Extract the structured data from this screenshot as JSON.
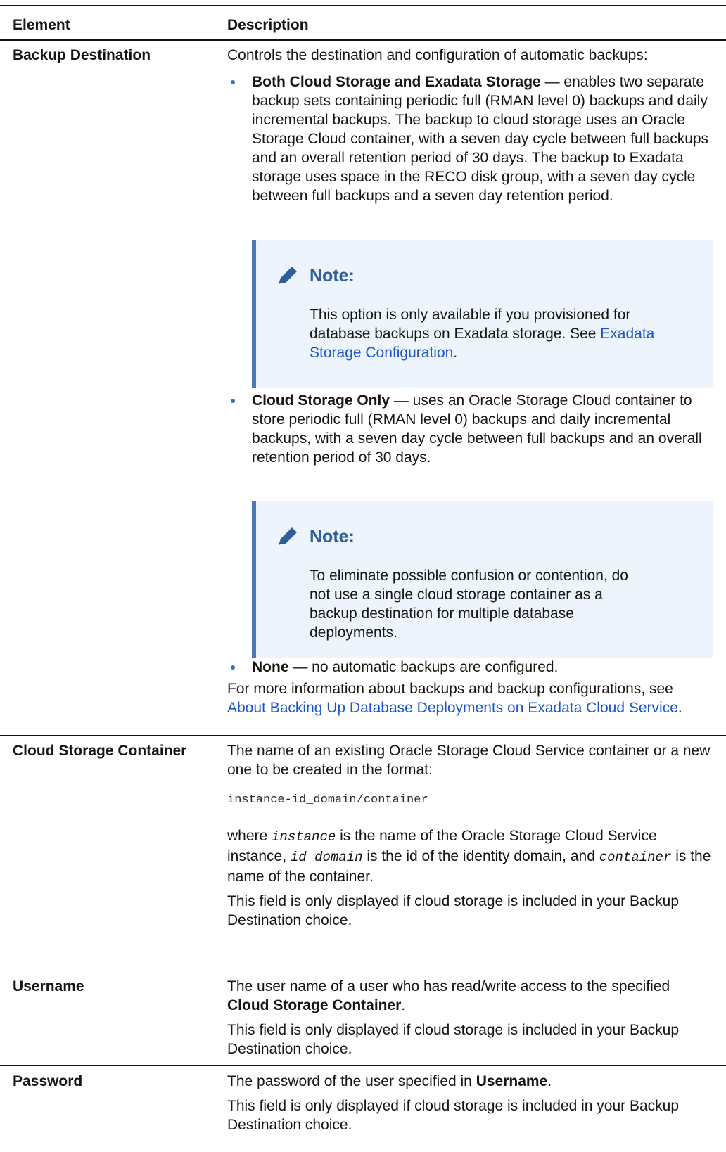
{
  "header": {
    "element": "Element",
    "description": "Description"
  },
  "backup_destination": {
    "element": "Backup Destination",
    "intro": "Controls the destination and configuration of automatic backups:",
    "opt1_title": "Both Cloud Storage and Exadata Storage",
    "opt1_text": " — enables two separate backup sets containing periodic full (RMAN level 0) backups and daily incremental backups. The backup to cloud storage uses an Oracle Storage Cloud container, with a seven day cycle between full backups and an overall retention period of 30 days. The backup to Exadata storage uses space in the RECO disk group, with a seven day cycle between full backups and a seven day retention period.",
    "note1_title": "Note:",
    "note1_text": "This option is only available if you provisioned for database backups on Exadata storage. See ",
    "note1_link": "Exadata Storage Configuration",
    "note1_end": ".",
    "opt2_title": "Cloud Storage Only",
    "opt2_text": " — uses an Oracle Storage Cloud container to store periodic full (RMAN level 0) backups and daily incremental backups, with a seven day cycle between full backups and an overall retention period of 30 days.",
    "note2_title": "Note:",
    "note2_text": "To eliminate possible confusion or contention, do not use a single cloud storage container as a backup destination for multiple database deployments.",
    "opt3_title": "None",
    "opt3_text": " — no automatic backups are configured.",
    "more_text": "For more information about backups and backup configurations, see ",
    "more_link": "About Backing Up Database Deployments on Exadata Cloud Service",
    "more_end": "."
  },
  "cloud_container": {
    "element": "Cloud Storage Container",
    "text1": "The name of an existing Oracle Storage Cloud Service container or a new one to be created in the format:",
    "code": "instance-id_domain/container",
    "where": "where ",
    "instance": "instance",
    "t_a": " is the name of the Oracle Storage Cloud Service instance, ",
    "id_domain": "id_domain",
    "t_b": " is the id of the identity domain, and ",
    "container": "container",
    "t_c": " is the name of the container.",
    "displayed": "This field is only displayed if cloud storage is included in your Backup Destination choice."
  },
  "username": {
    "element": "Username",
    "text_a": "The user name of a user who has read/write access to the specified ",
    "text_b": "Cloud Storage Container",
    "text_c": ".",
    "displayed": "This field is only displayed if cloud storage is included in your Backup Destination choice."
  },
  "password": {
    "element": "Password",
    "text_a": "The password of the user specified in ",
    "text_b": "Username",
    "text_c": ".",
    "displayed": "This field is only displayed if cloud storage is included in your Backup Destination choice."
  },
  "icons": {
    "note": "pencil-icon"
  },
  "colors": {
    "link": "#1a56c9",
    "note_bg": "#eef4fb",
    "note_bar": "#4a78b8",
    "note_title": "#2f5e98",
    "bullet": "#3a72b8"
  }
}
